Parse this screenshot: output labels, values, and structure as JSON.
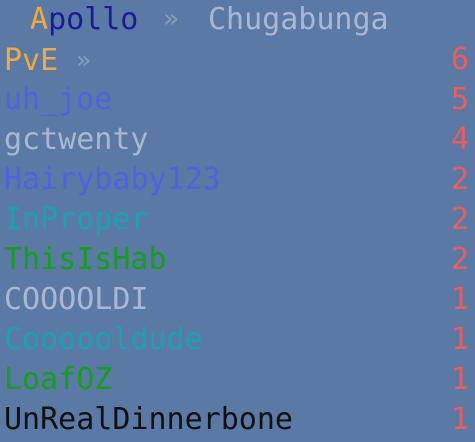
{
  "header": {
    "first": "Apollo",
    "separator": "»",
    "second": "Chugabunga"
  },
  "colors": {
    "background": "#5a7aa5",
    "score": "#ee5b5b",
    "separator": "#8e9cb4"
  },
  "rows": [
    {
      "name": "PvE",
      "separator": "»",
      "score": "6",
      "color": "#f2a93b"
    },
    {
      "name": "uh_joe",
      "separator": "",
      "score": "5",
      "color": "#4f63e0"
    },
    {
      "name": "gctwenty",
      "separator": "",
      "score": "4",
      "color": "#aab7d0"
    },
    {
      "name": "Hairybaby123",
      "separator": "",
      "score": "2",
      "color": "#4f63e0"
    },
    {
      "name": "InProper",
      "separator": "",
      "score": "2",
      "color": "#17a2b2"
    },
    {
      "name": "ThisIsHab",
      "separator": "",
      "score": "2",
      "color": "#14a019"
    },
    {
      "name": "COOOOLDI",
      "separator": "",
      "score": "1",
      "color": "#aab7d0"
    },
    {
      "name": "Coooooldude",
      "separator": "",
      "score": "1",
      "color": "#17a2b2"
    },
    {
      "name": "LoafOZ",
      "separator": "",
      "score": "1",
      "color": "#14a019"
    },
    {
      "name": "UnRealDinnerbone",
      "separator": "",
      "score": "1",
      "color": "#111111"
    }
  ]
}
